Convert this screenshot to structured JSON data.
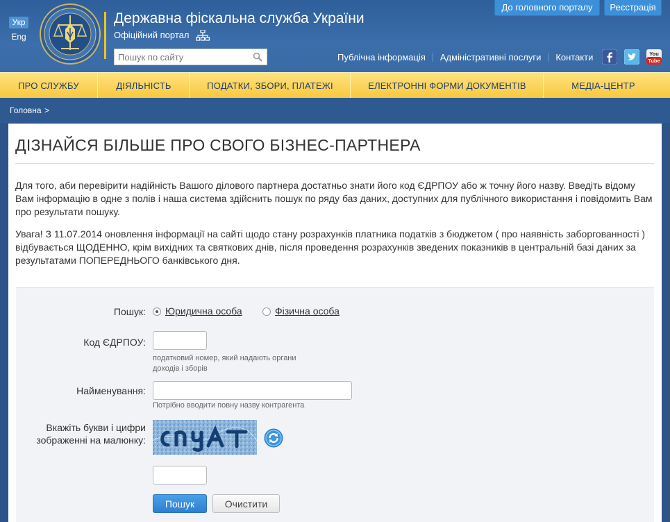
{
  "header": {
    "languages": [
      "Укр",
      "Eng"
    ],
    "site_title": "Державна фіскальна служба України",
    "portal_subtitle": "Офіційний портал",
    "search": {
      "placeholder": "Пошук по сайту"
    },
    "top_buttons": {
      "portal": "До головного порталу",
      "register": "Реєстрація"
    },
    "utility_links": [
      "Публічна інформація",
      "Адміністративні послуги",
      "Контакти"
    ],
    "social": [
      "facebook-icon",
      "twitter-icon",
      "youtube-icon"
    ],
    "colors": {
      "accent": "#f4c21a",
      "header_blue": "#3b6eaa",
      "button_blue": "#3c8fd9"
    }
  },
  "nav": {
    "items": [
      "ПРО СЛУЖБУ",
      "ДІЯЛЬНІСТЬ",
      "ПОДАТКИ, ЗБОРИ, ПЛАТЕЖІ",
      "ЕЛЕКТРОННІ ФОРМИ ДОКУМЕНТІВ",
      "МЕДІА-ЦЕНТР"
    ]
  },
  "breadcrumb": {
    "home": "Головна",
    "separator": ">"
  },
  "main": {
    "title": "ДІЗНАЙСЯ БІЛЬШЕ ПРО СВОГО БІЗНЕС-ПАРТНЕРА",
    "paragraph1": "Для того, аби перевірити надійність Вашого ділового партнера достатньо знати його код ЄДРПОУ або ж точну його назву. Введіть відому Вам інформацію в одне з полів і наша система здійснить пошук по ряду баз даних, доступних для публічного використання і повідомить Вам про результати пошуку.",
    "paragraph2": "Увага! З 11.07.2014 оновлення інформації на сайті щодо стану розрахунків платника податків з бюджетом ( про наявність заборгованності ) відбувається ЩОДЕННО, крім вихідних та святкових днів, після проведення розрахунків зведених показників в центральній базі даних за результатами ПОПЕРЕДНЬОГО банківського дня."
  },
  "form": {
    "search_label": "Пошук:",
    "radio_legal": "Юридична особа",
    "radio_physical": "Фізична особа",
    "selected": "legal",
    "edrpou_label": "Код ЄДРПОУ:",
    "edrpou_value": "",
    "edrpou_hint": "податковий номер, який надають органи доходів і зборів",
    "name_label": "Найменування:",
    "name_value": "",
    "name_hint": "Потрібно вводити повну назву контрагента",
    "captcha_label": "Вкажіть букви і цифри зображенні на малюнку:",
    "captcha_text": "cnyAT",
    "captcha_value": "",
    "submit": "Пошук",
    "clear": "Очистити"
  }
}
